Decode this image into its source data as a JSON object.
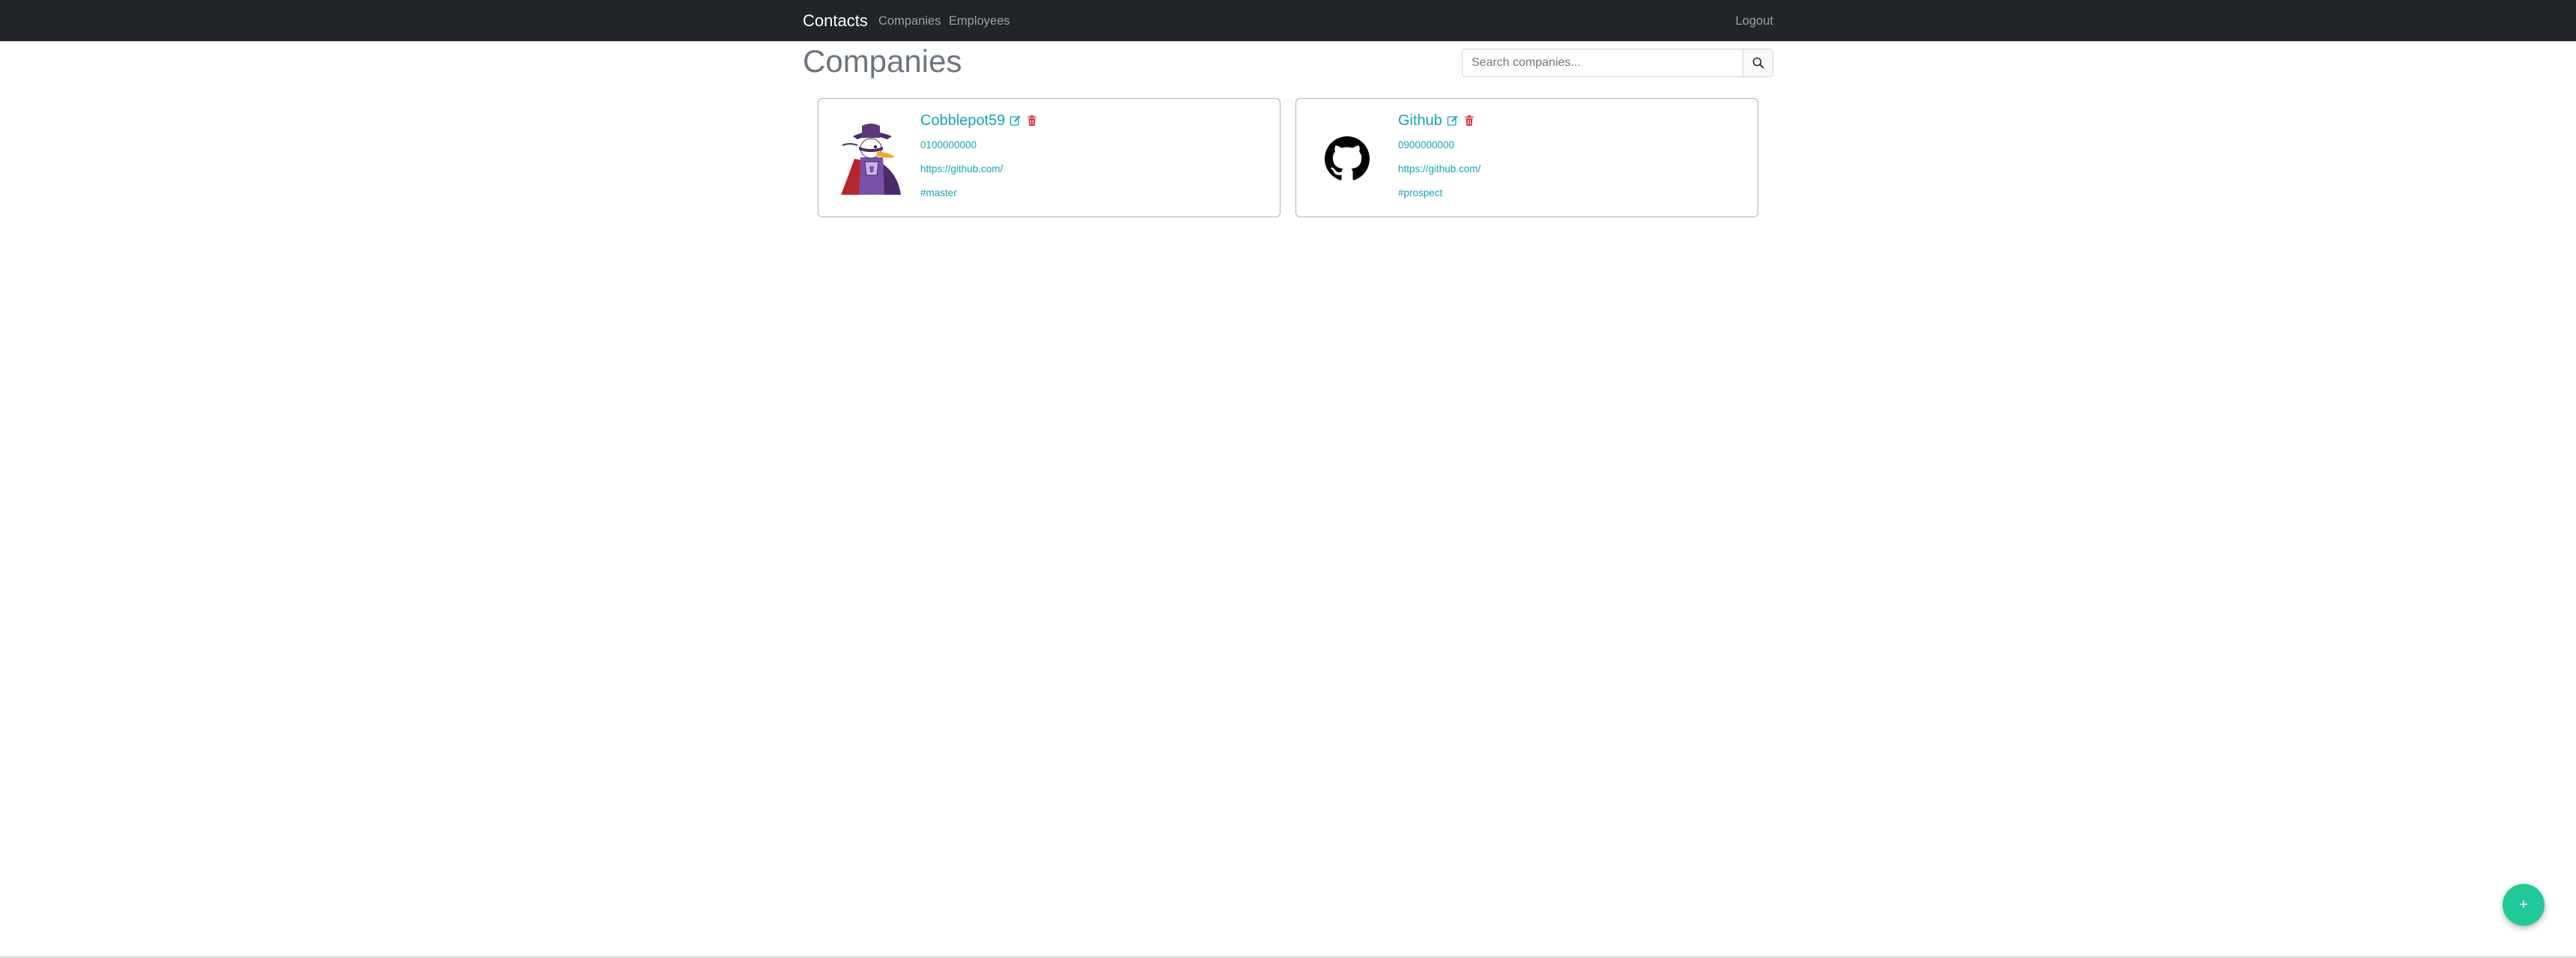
{
  "navbar": {
    "brand": "Contacts",
    "links": [
      "Companies",
      "Employees"
    ],
    "logout": "Logout"
  },
  "page": {
    "title": "Companies"
  },
  "search": {
    "placeholder": "Search companies...",
    "value": "",
    "button_icon": "search-icon"
  },
  "companies": [
    {
      "name": "Cobblepot59",
      "phone": "0100000000",
      "url": "https://github.com/",
      "tag": "#master",
      "logo_icon": "darkwing-duck-character-image"
    },
    {
      "name": "Github",
      "phone": "0900000000",
      "url": "https://github.com/",
      "tag": "#prospect",
      "logo_icon": "github-logo-icon"
    }
  ],
  "actions": {
    "edit_icon": "edit-icon",
    "delete_icon": "trash-icon"
  },
  "fab": {
    "label": "+",
    "icon": "plus-icon"
  },
  "colors": {
    "navbar_bg": "#212529",
    "link": "#17a2b8",
    "delete": "#dc3545",
    "fab": "#20c997",
    "title": "#6c757d"
  }
}
